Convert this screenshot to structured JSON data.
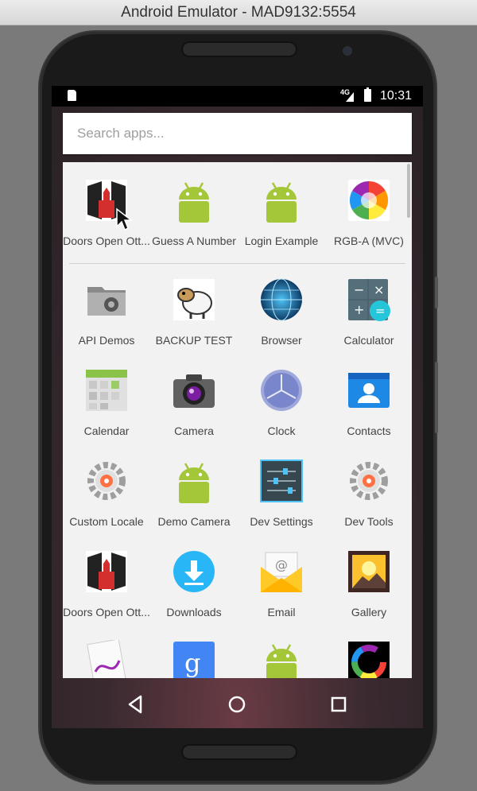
{
  "window": {
    "title": "Android Emulator - MAD9132:5554"
  },
  "status_bar": {
    "time": "10:31",
    "network_label": "4G"
  },
  "search": {
    "placeholder": "Search apps..."
  },
  "apps": [
    {
      "label": "Doors Open Ott...",
      "icon": "doors-open-ottawa-icon"
    },
    {
      "label": "Guess A Number",
      "icon": "android-icon"
    },
    {
      "label": "Login Example",
      "icon": "android-icon"
    },
    {
      "label": "RGB-A (MVC)",
      "icon": "color-wheel-icon"
    },
    {
      "label": "API Demos",
      "icon": "folder-gear-icon"
    },
    {
      "label": "BACKUP TEST",
      "icon": "sheep-icon"
    },
    {
      "label": "Browser",
      "icon": "globe-icon"
    },
    {
      "label": "Calculator",
      "icon": "calculator-icon"
    },
    {
      "label": "Calendar",
      "icon": "calendar-icon"
    },
    {
      "label": "Camera",
      "icon": "camera-icon"
    },
    {
      "label": "Clock",
      "icon": "clock-icon"
    },
    {
      "label": "Contacts",
      "icon": "contacts-icon"
    },
    {
      "label": "Custom Locale",
      "icon": "gear-locale-icon"
    },
    {
      "label": "Demo Camera",
      "icon": "android-icon"
    },
    {
      "label": "Dev Settings",
      "icon": "sliders-icon"
    },
    {
      "label": "Dev Tools",
      "icon": "gear-locale-icon"
    },
    {
      "label": "Doors Open Ott...",
      "icon": "doors-open-ottawa-icon"
    },
    {
      "label": "Downloads",
      "icon": "download-icon"
    },
    {
      "label": "Email",
      "icon": "email-icon"
    },
    {
      "label": "Gallery",
      "icon": "gallery-icon"
    },
    {
      "label": "",
      "icon": "gestures-icon"
    },
    {
      "label": "",
      "icon": "google-search-icon"
    },
    {
      "label": "",
      "icon": "android-icon"
    },
    {
      "label": "",
      "icon": "color-ring-icon"
    }
  ],
  "colors": {
    "android_green": "#a4c639",
    "screen_bg": "#4a2c35",
    "drawer_bg": "#f2f2f2"
  },
  "nav": {
    "back": "back-icon",
    "home": "home-icon",
    "recents": "recents-icon"
  }
}
